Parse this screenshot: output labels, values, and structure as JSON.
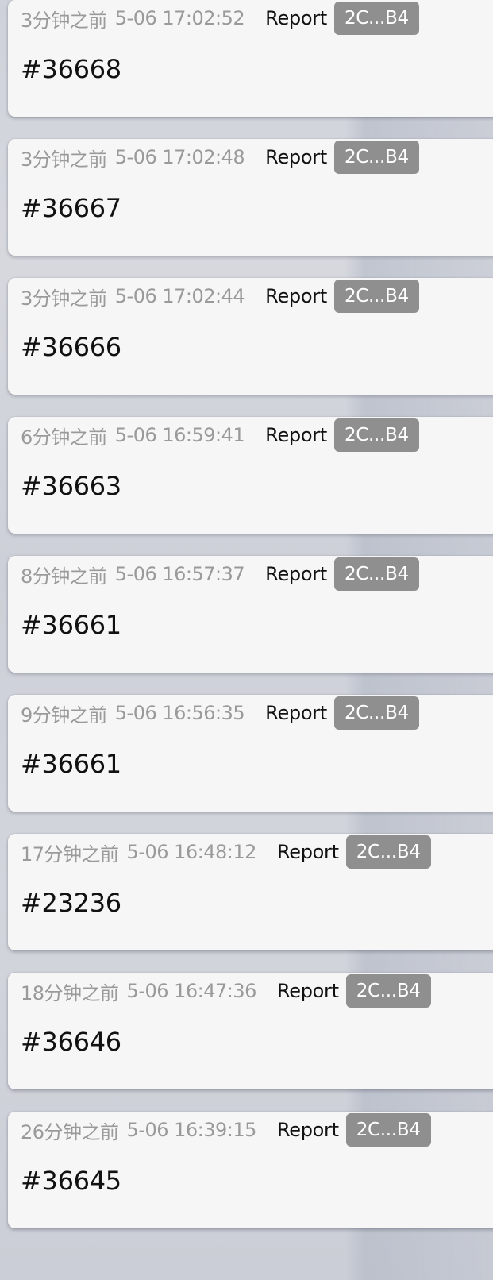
{
  "feed": {
    "items": [
      {
        "time_ago": "3分钟之前",
        "timestamp": "5-06 17:02:52",
        "label": "Report",
        "tag": "2C...B4",
        "number": "#36668"
      },
      {
        "time_ago": "3分钟之前",
        "timestamp": "5-06 17:02:48",
        "label": "Report",
        "tag": "2C...B4",
        "number": "#36667"
      },
      {
        "time_ago": "3分钟之前",
        "timestamp": "5-06 17:02:44",
        "label": "Report",
        "tag": "2C...B4",
        "number": "#36666"
      },
      {
        "time_ago": "6分钟之前",
        "timestamp": "5-06 16:59:41",
        "label": "Report",
        "tag": "2C...B4",
        "number": "#36663"
      },
      {
        "time_ago": "8分钟之前",
        "timestamp": "5-06 16:57:37",
        "label": "Report",
        "tag": "2C...B4",
        "number": "#36661"
      },
      {
        "time_ago": "9分钟之前",
        "timestamp": "5-06 16:56:35",
        "label": "Report",
        "tag": "2C...B4",
        "number": "#36661"
      },
      {
        "time_ago": "17分钟之前",
        "timestamp": "5-06 16:48:12",
        "label": "Report",
        "tag": "2C...B4",
        "number": "#23236"
      },
      {
        "time_ago": "18分钟之前",
        "timestamp": "5-06 16:47:36",
        "label": "Report",
        "tag": "2C...B4",
        "number": "#36646"
      },
      {
        "time_ago": "26分钟之前",
        "timestamp": "5-06 16:39:15",
        "label": "Report",
        "tag": "2C...B4",
        "number": "#36645"
      }
    ]
  }
}
